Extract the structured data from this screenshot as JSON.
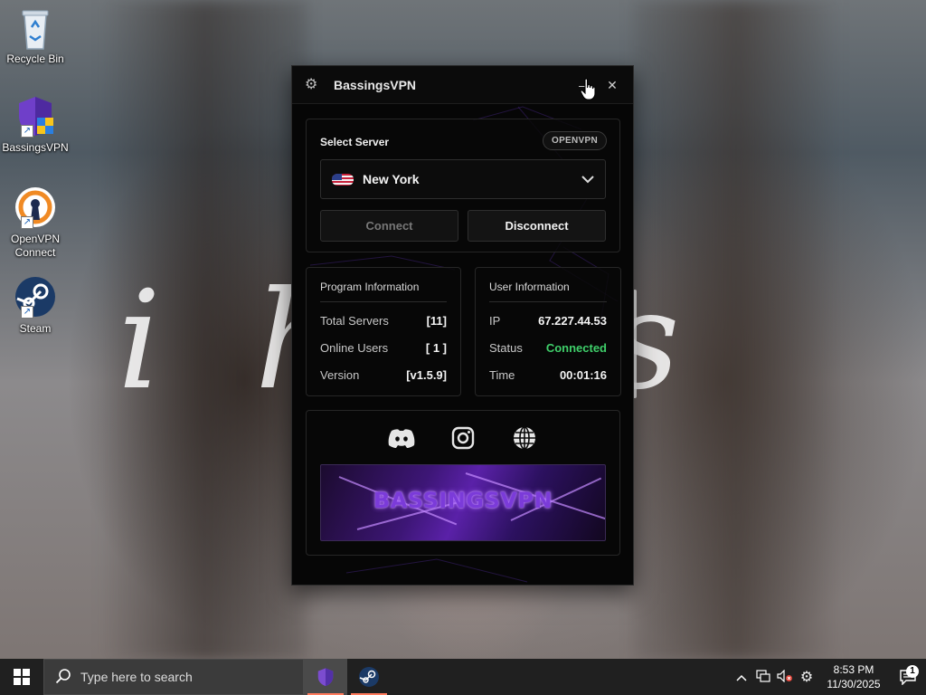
{
  "wallpaper": {
    "script_text": "i h       ies"
  },
  "desktop": {
    "icons": [
      {
        "label": "Recycle Bin"
      },
      {
        "label": "BassingsVPN"
      },
      {
        "label": "OpenVPN Connect"
      },
      {
        "label": "Steam"
      }
    ]
  },
  "vpn": {
    "title": "BassingsVPN",
    "server": {
      "label": "Select Server",
      "protocol": "OPENVPN",
      "selected": "New York",
      "connect_label": "Connect",
      "disconnect_label": "Disconnect"
    },
    "program_info": {
      "title": "Program Information",
      "rows": [
        {
          "key": "Total Servers",
          "value": "[11]"
        },
        {
          "key": "Online Users",
          "value": "[ 1 ]"
        },
        {
          "key": "Version",
          "value": "[v1.5.9]"
        }
      ]
    },
    "user_info": {
      "title": "User Information",
      "rows": [
        {
          "key": "IP",
          "value": "67.227.44.53"
        },
        {
          "key": "Status",
          "value": "Connected"
        },
        {
          "key": "Time",
          "value": "00:01:16"
        }
      ]
    },
    "banner_text": "BASSINGSVPN",
    "colors": {
      "accent": "#7b3bd9",
      "status_ok": "#3fcf6a"
    }
  },
  "taskbar": {
    "search_placeholder": "Type here to search",
    "time": "8:53 PM",
    "date": "11/30/2025",
    "notification_count": "1"
  }
}
